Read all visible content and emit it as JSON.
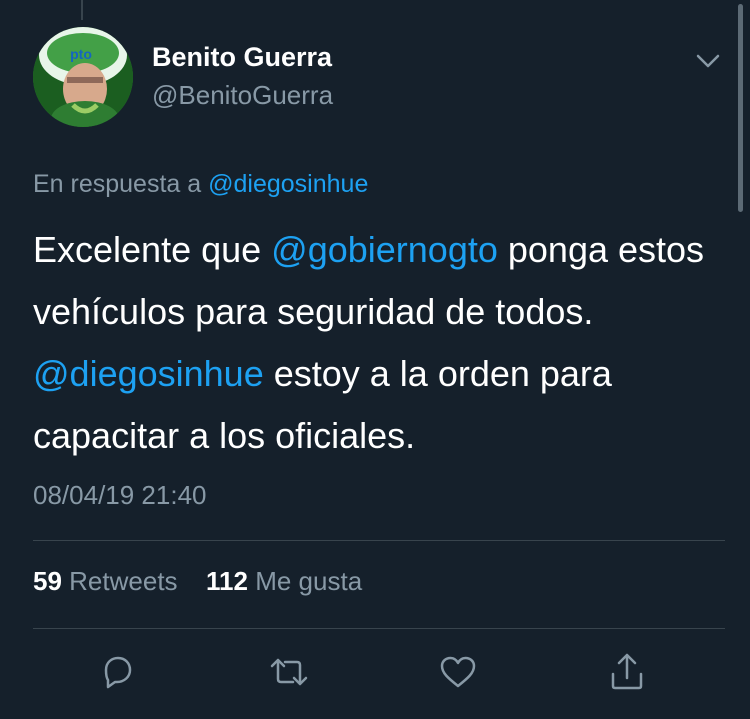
{
  "tweet": {
    "display_name": "Benito Guerra",
    "handle": "@BenitoGuerra",
    "reply_prefix": "En respuesta a",
    "reply_to": "@diegosinhue",
    "text_parts": [
      "Excelente que ",
      "@gobiernogto",
      " ponga estos vehículos para seguridad de todos. ",
      "@diegosinhue",
      " estoy a la orden para capacitar a los oficiales."
    ],
    "timestamp": "08/04/19 21:40"
  },
  "stats": {
    "retweets_count": "59",
    "retweets_label": "Retweets",
    "likes_count": "112",
    "likes_label": "Me gusta"
  },
  "icons": {
    "chevron": "chevron-down-icon",
    "reply": "reply-icon",
    "retweet": "retweet-icon",
    "like": "heart-icon",
    "share": "share-icon"
  },
  "colors": {
    "background": "#15202b",
    "primary_text": "#ffffff",
    "secondary_text": "#8899a6",
    "link": "#1da1f2",
    "divider": "#38444d"
  }
}
